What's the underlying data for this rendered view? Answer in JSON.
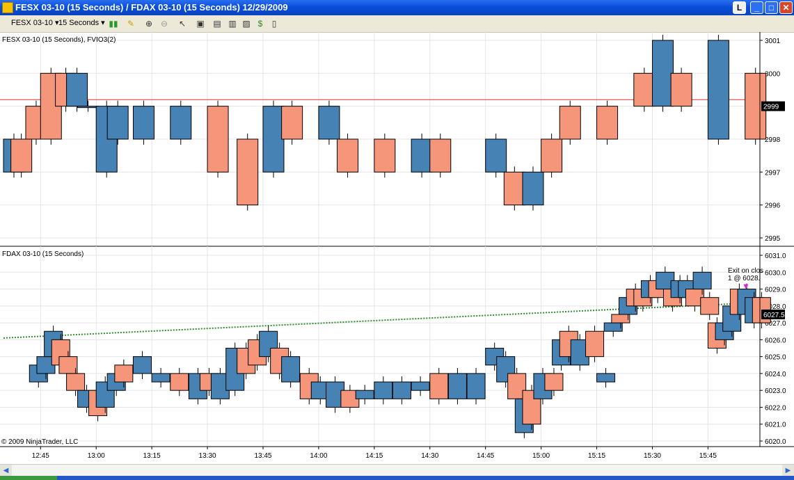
{
  "window": {
    "title": "FESX 03-10 (15 Seconds) / FDAX 03-10 (15 Seconds)  12/29/2009",
    "link_button": "L"
  },
  "toolbar": {
    "instrument": "FESX 03-10",
    "interval": "15 Seconds"
  },
  "colors": {
    "up_bar": "#f5967a",
    "down_bar": "#4682b4",
    "grid": "#e5e5e5",
    "hline": "#e03030",
    "trend": "#2e8b2e",
    "marker": "#e020e0"
  },
  "chart_data": [
    {
      "type": "boxes",
      "title": "FESX 03-10 (15 Seconds), FVIO3(2)",
      "ylim": [
        2995,
        3001
      ],
      "y_ticks": [
        "3001",
        "3000",
        "2999",
        "2998",
        "2997",
        "2996",
        "2995"
      ],
      "price_marker": "2999",
      "horizontal_line": 2999.2,
      "series": [
        {
          "x": [
            "12:35",
            "12:37",
            "12:41",
            "12:45",
            "12:49",
            "12:52",
            "12:55",
            "13:00",
            "13:03",
            "13:10",
            "13:20",
            "13:30",
            "13:38",
            "13:45",
            "13:50",
            "14:00",
            "14:05",
            "14:15",
            "14:25",
            "14:30",
            "14:45",
            "14:50",
            "14:55",
            "15:00",
            "15:05",
            "15:15",
            "15:25",
            "15:30",
            "15:35",
            "15:45",
            "15:55"
          ],
          "low": [
            2997,
            2997,
            2998,
            2998,
            2999,
            2999,
            2999,
            2997,
            2998,
            2998,
            2998,
            2997,
            2996,
            2997,
            2998,
            2998,
            2997,
            2997,
            2997,
            2997,
            2997,
            2996,
            2996,
            2997,
            2998,
            2998,
            2999,
            2999,
            2999,
            2998,
            2998
          ],
          "high": [
            2998,
            2998,
            2999,
            3000,
            3000,
            3000,
            2999,
            2999,
            2999,
            2999,
            2999,
            2999,
            2998,
            2999,
            2999,
            2999,
            2998,
            2998,
            2998,
            2998,
            2998,
            2997,
            2997,
            2998,
            2999,
            2999,
            3000,
            3001,
            3000,
            3001,
            3000
          ],
          "dir": [
            "dn",
            "up",
            "up",
            "up",
            "up",
            "dn",
            "dn",
            "dn",
            "dn",
            "dn",
            "dn",
            "up",
            "up",
            "dn",
            "up",
            "dn",
            "up",
            "up",
            "dn",
            "up",
            "dn",
            "up",
            "dn",
            "up",
            "up",
            "up",
            "up",
            "dn",
            "up",
            "dn",
            "up"
          ]
        }
      ]
    },
    {
      "type": "boxes",
      "title": "FDAX 03-10 (15 Seconds)",
      "ylim": [
        6020,
        6031
      ],
      "y_ticks": [
        "6031.0",
        "6030.0",
        "6029.0",
        "6028.0",
        "6027.0",
        "6026.0",
        "6025.0",
        "6024.0",
        "6023.0",
        "6022.0",
        "6021.0",
        "6020.0"
      ],
      "price_marker": "6027.5",
      "trend_line": {
        "from": [
          "12:35",
          6026.1
        ],
        "to": [
          "15:59",
          6028.2
        ]
      },
      "annotation": [
        "Exit on clos",
        "1 @ 6028."
      ],
      "copyright": "© 2009 NinjaTrader, LLC",
      "x_ticks": [
        "12:45",
        "13:00",
        "13:15",
        "13:30",
        "13:45",
        "14:00",
        "14:15",
        "14:30",
        "14:45",
        "15:00",
        "15:15",
        "15:30",
        "15:45"
      ],
      "series": [
        {
          "x": [
            "12:42",
            "12:44",
            "12:46",
            "12:48",
            "12:50",
            "12:52",
            "12:55",
            "12:58",
            "13:00",
            "13:03",
            "13:05",
            "13:10",
            "13:15",
            "13:20",
            "13:25",
            "13:28",
            "13:31",
            "13:35",
            "13:38",
            "13:41",
            "13:44",
            "13:47",
            "13:50",
            "13:55",
            "13:58",
            "14:02",
            "14:06",
            "14:10",
            "14:15",
            "14:20",
            "14:25",
            "14:30",
            "14:35",
            "14:40",
            "14:45",
            "14:48",
            "14:51",
            "14:53",
            "14:55",
            "14:58",
            "15:01",
            "15:03",
            "15:05",
            "15:08",
            "15:12",
            "15:15",
            "15:17",
            "15:19",
            "15:21",
            "15:23",
            "15:25",
            "15:27",
            "15:29",
            "15:31",
            "15:33",
            "15:35",
            "15:37",
            "15:39",
            "15:41",
            "15:43",
            "15:45",
            "15:47",
            "15:49",
            "15:51",
            "15:53",
            "15:55",
            "15:57"
          ],
          "low": [
            6023.5,
            6024.0,
            6025.0,
            6024.5,
            6024.0,
            6023.0,
            6022.0,
            6021.5,
            6022.0,
            6023.0,
            6023.5,
            6024.0,
            6023.5,
            6023.0,
            6022.5,
            6023.0,
            6022.5,
            6023.0,
            6024.0,
            6024.5,
            6025.0,
            6024.0,
            6023.5,
            6022.5,
            6022.5,
            6022.0,
            6022.0,
            6022.5,
            6022.5,
            6022.5,
            6023.0,
            6022.5,
            6022.5,
            6022.5,
            6024.5,
            6023.5,
            6022.5,
            6020.5,
            6021.0,
            6022.5,
            6023.0,
            6024.5,
            6025.0,
            6024.5,
            6025.0,
            6023.5,
            6026.5,
            6027.0,
            6027.5,
            6028.0,
            6028.0,
            6028.5,
            6028.5,
            6029.0,
            6028.0,
            6028.5,
            6028.5,
            6028.0,
            6029.0,
            6027.5,
            6025.5,
            6026.0,
            6026.5,
            6027.5,
            6027.5,
            6027.0,
            6027.0
          ],
          "high": [
            6024.5,
            6025.0,
            6026.5,
            6026.0,
            6025.0,
            6024.0,
            6023.0,
            6023.0,
            6023.5,
            6024.0,
            6024.5,
            6025.0,
            6024.0,
            6024.0,
            6024.0,
            6024.0,
            6024.0,
            6025.5,
            6025.5,
            6026.0,
            6026.5,
            6025.5,
            6025.0,
            6024.0,
            6023.5,
            6023.5,
            6023.0,
            6023.0,
            6023.5,
            6023.5,
            6023.5,
            6024.0,
            6024.0,
            6024.0,
            6025.5,
            6025.0,
            6024.0,
            6022.5,
            6023.0,
            6024.0,
            6024.0,
            6026.0,
            6026.5,
            6026.0,
            6026.5,
            6024.0,
            6027.0,
            6027.5,
            6028.5,
            6029.0,
            6029.0,
            6029.5,
            6029.5,
            6030.0,
            6029.0,
            6029.5,
            6029.5,
            6029.0,
            6030.0,
            6028.5,
            6027.0,
            6027.0,
            6028.0,
            6029.0,
            6029.0,
            6028.5,
            6028.5
          ],
          "dir": [
            "dn",
            "dn",
            "dn",
            "up",
            "up",
            "up",
            "dn",
            "up",
            "dn",
            "dn",
            "up",
            "dn",
            "dn",
            "up",
            "dn",
            "up",
            "dn",
            "dn",
            "up",
            "up",
            "dn",
            "up",
            "dn",
            "up",
            "dn",
            "dn",
            "up",
            "dn",
            "dn",
            "dn",
            "dn",
            "up",
            "dn",
            "dn",
            "dn",
            "dn",
            "up",
            "dn",
            "up",
            "dn",
            "up",
            "dn",
            "up",
            "dn",
            "up",
            "dn",
            "dn",
            "up",
            "dn",
            "up",
            "up",
            "dn",
            "up",
            "dn",
            "up",
            "dn",
            "dn",
            "up",
            "dn",
            "up",
            "up",
            "dn",
            "dn",
            "up",
            "dn",
            "dn",
            "up"
          ]
        }
      ]
    }
  ]
}
